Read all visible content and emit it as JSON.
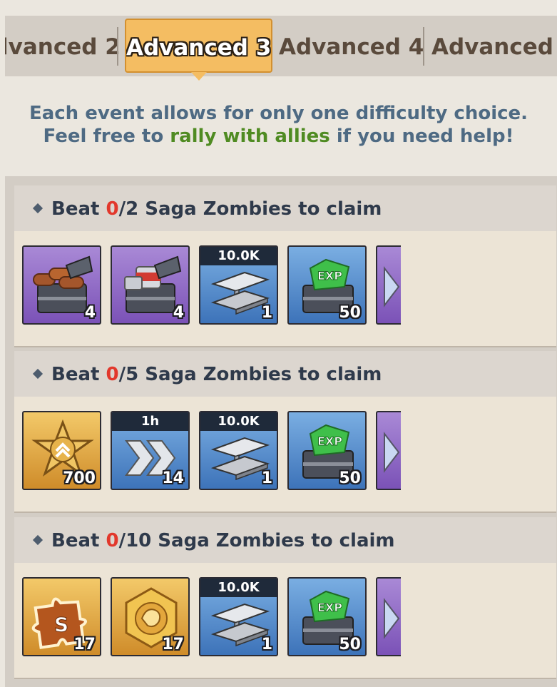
{
  "tabs": [
    {
      "label": "lvanced 2",
      "active": false
    },
    {
      "label": "Advanced 3",
      "active": true
    },
    {
      "label": "Advanced 4",
      "active": false
    },
    {
      "label": "Advanced",
      "active": false
    }
  ],
  "notice": {
    "line1": "Each event allows for only one difficulty choice.",
    "line2_pre": "Feel free to ",
    "line2_highlight": "rally with allies",
    "line2_post": " if you need help!"
  },
  "colors": {
    "active_tab": "#f4bd62",
    "highlight_green": "#4f8b22",
    "progress_red": "#e2382c",
    "notice_blue": "#4e6a83"
  },
  "tiers": [
    {
      "prefix": "Beat ",
      "current": "0",
      "suffix": "/2 Saga Zombies to claim",
      "rewards": [
        {
          "icon": "wood-chest-icon",
          "rarity": "purple",
          "qty": "4"
        },
        {
          "icon": "canned-food-chest-icon",
          "rarity": "purple",
          "qty": "4"
        },
        {
          "icon": "steel-beam-icon",
          "rarity": "blue",
          "label": "10.0K",
          "qty": "1"
        },
        {
          "icon": "exp-chest-icon",
          "rarity": "blue",
          "qty": "50"
        },
        {
          "icon": "diamond-icon",
          "rarity": "purple",
          "qty": ""
        }
      ]
    },
    {
      "prefix": "Beat ",
      "current": "0",
      "suffix": "/5 Saga Zombies to claim",
      "rewards": [
        {
          "icon": "sheriff-badge-icon",
          "rarity": "gold",
          "qty": "700"
        },
        {
          "icon": "speedup-icon",
          "rarity": "blue",
          "label": "1h",
          "qty": "14"
        },
        {
          "icon": "steel-beam-icon",
          "rarity": "blue",
          "label": "10.0K",
          "qty": "1"
        },
        {
          "icon": "exp-chest-icon",
          "rarity": "blue",
          "qty": "50"
        },
        {
          "icon": "diamond-icon",
          "rarity": "purple",
          "qty": ""
        }
      ]
    },
    {
      "prefix": "Beat ",
      "current": "0",
      "suffix": "/10 Saga Zombies to claim",
      "rewards": [
        {
          "icon": "skill-puzzle-icon",
          "rarity": "gold",
          "qty": "17"
        },
        {
          "icon": "lion-medal-icon",
          "rarity": "gold",
          "qty": "17"
        },
        {
          "icon": "steel-beam-icon",
          "rarity": "blue",
          "label": "10.0K",
          "qty": "1"
        },
        {
          "icon": "exp-chest-icon",
          "rarity": "blue",
          "qty": "50"
        },
        {
          "icon": "diamond-icon",
          "rarity": "purple",
          "qty": ""
        }
      ]
    }
  ]
}
